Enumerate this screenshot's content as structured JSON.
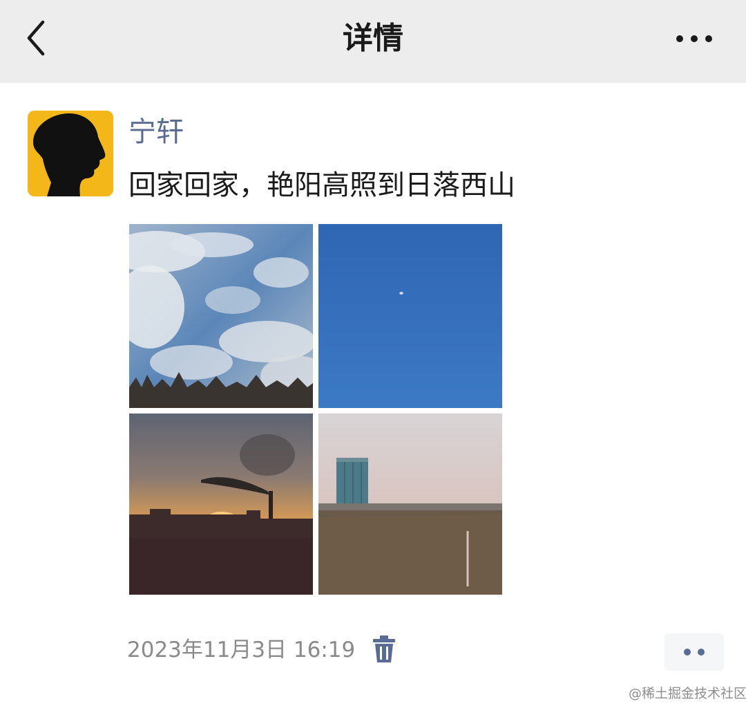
{
  "header": {
    "title": "详情",
    "back_icon": "chevron-left-icon",
    "more_icon": "more-dots-icon"
  },
  "post": {
    "author": "宁轩",
    "text": "回家回家，艳阳高照到日落西山",
    "avatar_color": "#f3b71a",
    "photos": [
      {
        "subject": "clouds-sky"
      },
      {
        "subject": "clear-blue-sky"
      },
      {
        "subject": "sunset-chimney-smoke"
      },
      {
        "subject": "tall-building-field"
      }
    ],
    "timestamp": "2023年11月3日 16:19",
    "delete_icon": "trash-icon",
    "action_icon": "comment-dots-icon"
  },
  "colors": {
    "link": "#5a6c93",
    "header_bg": "#ededed",
    "muted": "#8a8a8a"
  },
  "watermark": "@稀土掘金技术社区"
}
